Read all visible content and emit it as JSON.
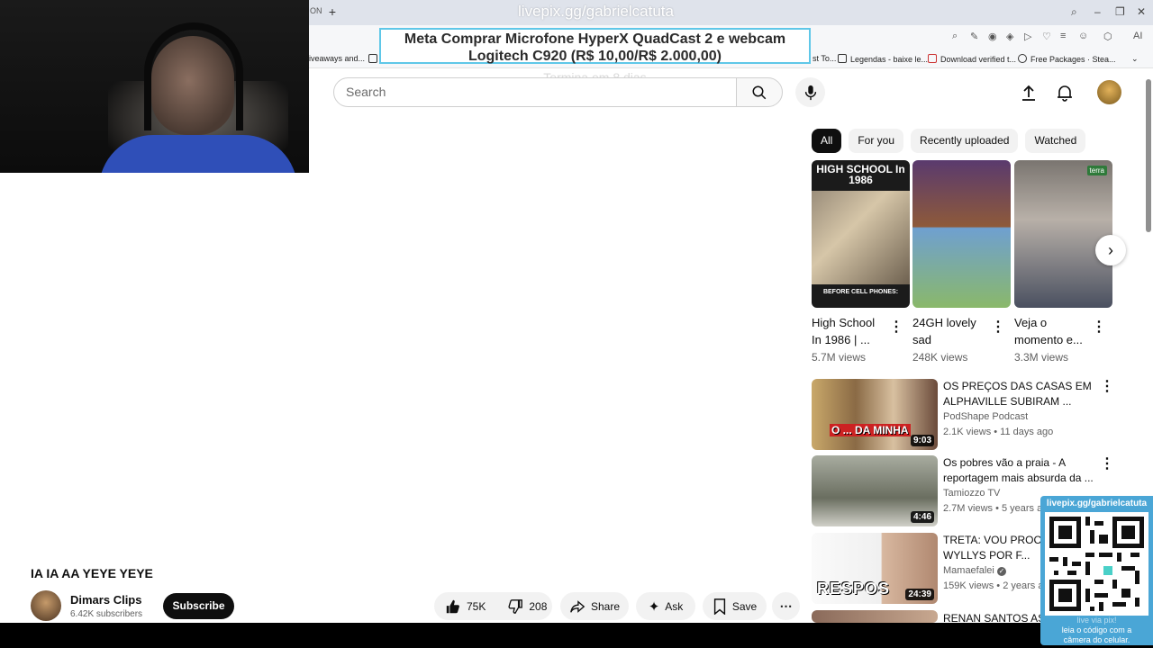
{
  "browser": {
    "tab_fragment": "ON",
    "bookmarks": [
      {
        "label": "iveaways and...",
        "icon": "page-icon"
      },
      {
        "label": "st To...",
        "icon": "page-icon"
      },
      {
        "label": "Legendas - baixe le...",
        "icon": "subtitle-icon"
      },
      {
        "label": "Download verified t...",
        "icon": "download-icon"
      },
      {
        "label": "Free Packages · Stea...",
        "icon": "steam-icon"
      }
    ],
    "toolbar_extra": "AI"
  },
  "overlay": {
    "livepix_top": "livepix.gg/gabrielcatuta",
    "goal_line1": "Meta Comprar Microfone HyperX QuadCast 2 e webcam",
    "goal_line2": "Logitech C920 (R$ 10,00/R$ 2.000,00)",
    "goal_sub": "Termina em 8 dias",
    "qr_header": "livepix.gg/gabrielcatuta",
    "qr_footer_1": "live via pix!",
    "qr_footer_2": "leia o código com a",
    "qr_footer_3": "câmera do celular."
  },
  "masthead": {
    "search_placeholder": "Search"
  },
  "chips": [
    "All",
    "For you",
    "Recently uploaded",
    "Watched"
  ],
  "shorts": [
    {
      "thumb_top": "HIGH SCHOOL In 1986",
      "thumb_bottom": "BEFORE CELL PHONES:",
      "title": "High School In 1986 | ...",
      "views": "5.7M views"
    },
    {
      "title": "24GH lovely sad",
      "views": "248K views"
    },
    {
      "thumb_badge": "terra",
      "title": "Veja o momento e...",
      "views": "3.3M views"
    }
  ],
  "videos": [
    {
      "title": "OS PREÇOS DAS CASAS EM ALPHAVILLE SUBIRAM ...",
      "channel": "PodShape Podcast",
      "meta": "2.1K views • 11 days ago",
      "duration": "9:03",
      "thumb_caption": "O ... DA MINHA"
    },
    {
      "title": "Os pobres vão a praia - A reportagem mais absurda da ...",
      "channel": "Tamiozzo TV",
      "meta": "2.7M views • 5 years ago",
      "duration": "4:46"
    },
    {
      "title": "TRETA: VOU PROCES... JEAN WYLLYS POR F...",
      "channel": "Mamaefalei",
      "meta": "159K views • 2 years ago",
      "duration": "24:39",
      "thumb_caption": "RESPOS"
    },
    {
      "title": "RENAN SANTOS ASS..."
    }
  ],
  "video": {
    "title": "IA IA AA YEYE YEYE",
    "channel": "Dimars Clips",
    "subscribers": "6.42K subscribers",
    "subscribe_label": "Subscribe",
    "likes": "75K",
    "dislikes": "208",
    "share_label": "Share",
    "ask_label": "Ask",
    "save_label": "Save"
  }
}
